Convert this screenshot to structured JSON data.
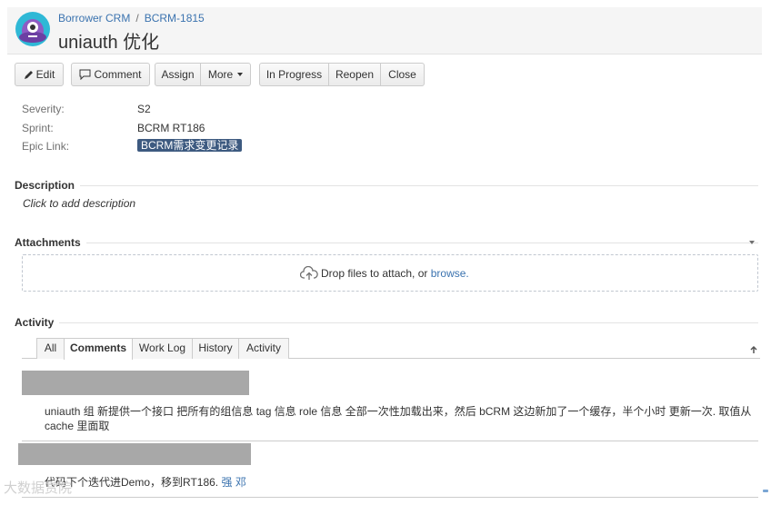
{
  "header": {
    "breadcrumb_project": "Borrower CRM",
    "breadcrumb_sep": "/",
    "breadcrumb_issue": "BCRM-1815",
    "title": "uniauth 优化"
  },
  "toolbar": {
    "edit": "Edit",
    "comment": "Comment",
    "assign": "Assign",
    "more": "More",
    "in_progress": "In Progress",
    "reopen": "Reopen",
    "close": "Close"
  },
  "fields": {
    "severity_label": "Severity:",
    "severity_value": "S2",
    "sprint_label": "Sprint:",
    "sprint_value": "BCRM RT186",
    "epic_label": "Epic Link:",
    "epic_value": "BCRM需求变更记录"
  },
  "description": {
    "title": "Description",
    "placeholder": "Click to add description"
  },
  "attachments": {
    "title": "Attachments",
    "drop_text": "Drop files to attach, or",
    "browse": "browse."
  },
  "activity": {
    "title": "Activity",
    "tabs": [
      "All",
      "Comments",
      "Work Log",
      "History",
      "Activity"
    ],
    "active_tab": "Comments",
    "comments": [
      {
        "body": "uniauth 组 新提供一个接口 把所有的组信息 tag 信息 role 信息 全部一次性加载出来，然后 bCRM 这边新加了一个缓存，半个小时 更新一次. 取值从cache 里面取"
      },
      {
        "body": "代码下个迭代进Demo，移到RT186.",
        "author": "强 邓"
      }
    ]
  },
  "watermark": "大数据赏院",
  "colors": {
    "link": "#3b73af",
    "lozenge": "#3d5a80",
    "redaction": "#a8a8a8",
    "header_bg": "#f5f5f5"
  },
  "icons": {
    "avatar": "purple-monster-avatar",
    "edit": "pencil-icon",
    "comment": "speech-bubble-icon",
    "upload": "cloud-upload-icon",
    "collapse": "chevron-down-icon",
    "scroll_top": "arrow-up-icon"
  }
}
